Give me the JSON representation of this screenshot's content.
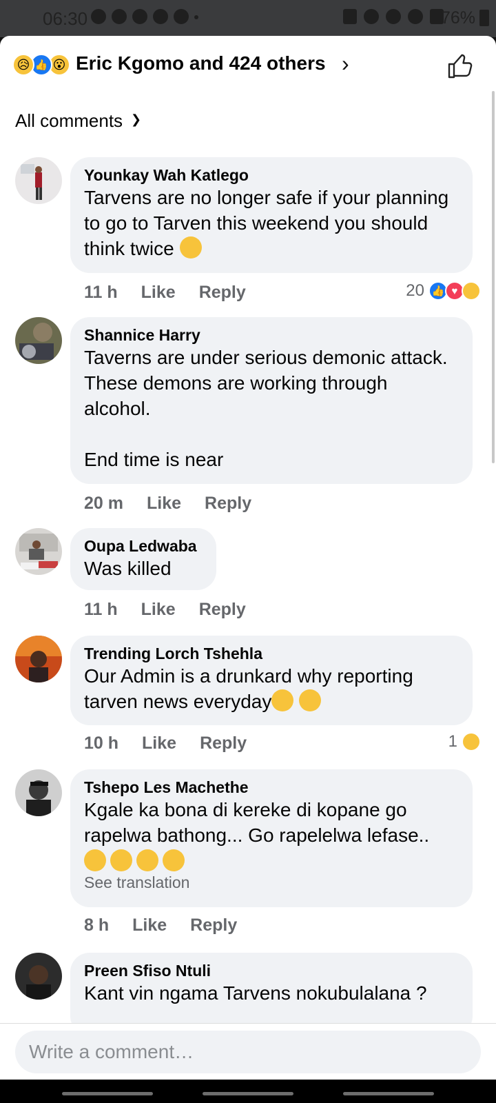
{
  "status_bar": {
    "time": "06:30",
    "battery": "76%"
  },
  "header": {
    "reactions": [
      "sad-reaction",
      "like-reaction",
      "wow-reaction"
    ],
    "summary": "Eric Kgomo and 424 others",
    "like_icon": "thumbs-up-outline-icon"
  },
  "filter": {
    "label": "All comments"
  },
  "comments": [
    {
      "author": "Younkay Wah Katlego",
      "text": "Tarvens are no longer safe if your planning to go to Tarven this weekend you should think twice",
      "emoji": "thinking-face",
      "time": "11 h",
      "like": "Like",
      "reply": "Reply",
      "reaction_count": "20",
      "reactions": [
        "like",
        "love",
        "sad"
      ]
    },
    {
      "author": "Shannice Harry",
      "text": "Taverns are under serious demonic attack.   These demons are working through alcohol.\n\nEnd time is near",
      "time": "20 m",
      "like": "Like",
      "reply": "Reply"
    },
    {
      "author": "Oupa Ledwaba",
      "text": "Was killed",
      "time": "11 h",
      "like": "Like",
      "reply": "Reply"
    },
    {
      "author": "Trending Lorch Tshehla",
      "text": "Our Admin is a drunkard why reporting tarven news everyday",
      "emoji": "writing-hand, sleepy-face",
      "time": "10 h",
      "like": "Like",
      "reply": "Reply",
      "reaction_count": "1",
      "reactions": [
        "haha"
      ]
    },
    {
      "author": "Tshepo Les Machethe",
      "text": "Kgale ka bona di kereke di kopane go rapelwa bathong... Go rapelelwa lefase..",
      "emoji": "folded-hands x4",
      "translate": "See translation",
      "time": "8 h",
      "like": "Like",
      "reply": "Reply"
    },
    {
      "author": "Preen Sfiso Ntuli",
      "text": "Kant vin ngama Tarvens nokubulalana ?"
    }
  ],
  "composer": {
    "placeholder": "Write a comment…"
  },
  "colors": {
    "accent": "#1877f2",
    "bubble": "#f0f2f5",
    "meta": "#65676b"
  }
}
